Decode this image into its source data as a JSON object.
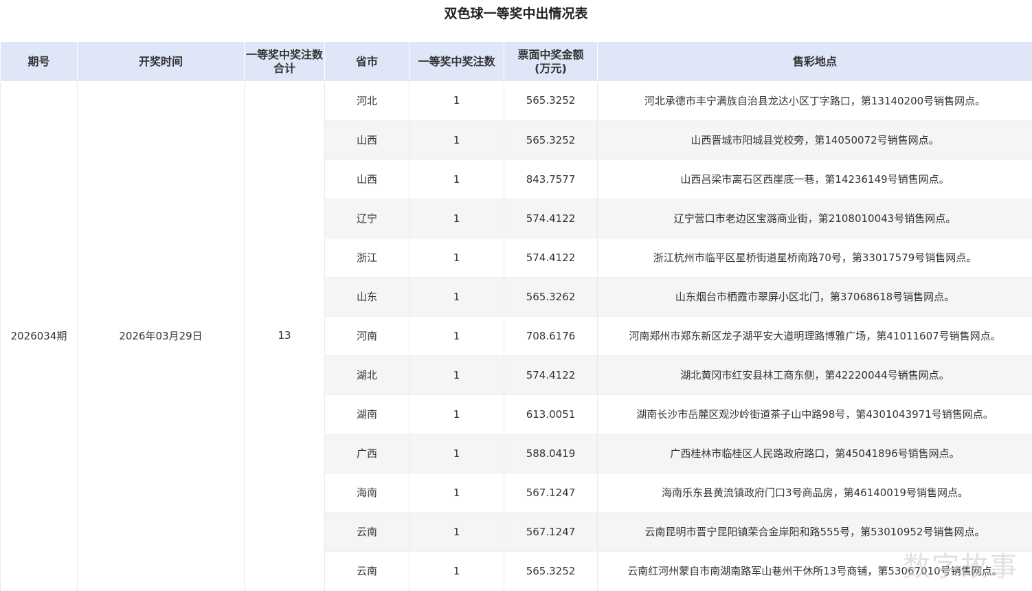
{
  "page": {
    "title": "双色球一等奖中出情况表"
  },
  "table": {
    "headers": {
      "period": "期号",
      "draw_time": "开奖时间",
      "total_count_line1": "一等奖中奖注数",
      "total_count_line2": "合计",
      "province": "省市",
      "count": "一等奖中奖注数",
      "amount_line1": "票面中奖金额",
      "amount_line2": "(万元)",
      "location": "售彩地点"
    },
    "period": "2026034期",
    "draw_time": "2026年03月29日",
    "total_count": "13",
    "rows": [
      {
        "province": "河北",
        "count": "1",
        "amount": "565.3252",
        "location": "河北承德市丰宁满族自治县龙达小区丁字路口，第13140200号销售网点。"
      },
      {
        "province": "山西",
        "count": "1",
        "amount": "565.3252",
        "location": "山西晋城市阳城县党校旁，第14050072号销售网点。"
      },
      {
        "province": "山西",
        "count": "1",
        "amount": "843.7577",
        "location": "山西吕梁市离石区西崖底一巷，第14236149号销售网点。"
      },
      {
        "province": "辽宁",
        "count": "1",
        "amount": "574.4122",
        "location": "辽宁营口市老边区宝潞商业街，第2108010043号销售网点。"
      },
      {
        "province": "浙江",
        "count": "1",
        "amount": "574.4122",
        "location": "浙江杭州市临平区星桥街道星桥南路70号，第33017579号销售网点。"
      },
      {
        "province": "山东",
        "count": "1",
        "amount": "565.3262",
        "location": "山东烟台市栖霞市翠屏小区北门，第37068618号销售网点。"
      },
      {
        "province": "河南",
        "count": "1",
        "amount": "708.6176",
        "location": "河南郑州市郑东新区龙子湖平安大道明理路博雅广场，第41011607号销售网点。"
      },
      {
        "province": "湖北",
        "count": "1",
        "amount": "574.4122",
        "location": "湖北黄冈市红安县林工商东侧，第42220044号销售网点。"
      },
      {
        "province": "湖南",
        "count": "1",
        "amount": "613.0051",
        "location": "湖南长沙市岳麓区观沙岭街道茶子山中路98号，第4301043971号销售网点。"
      },
      {
        "province": "广西",
        "count": "1",
        "amount": "588.0419",
        "location": "广西桂林市临桂区人民路政府路口，第45041896号销售网点。"
      },
      {
        "province": "海南",
        "count": "1",
        "amount": "567.1247",
        "location": "海南乐东县黄流镇政府门口3号商品房，第46140019号销售网点。"
      },
      {
        "province": "云南",
        "count": "1",
        "amount": "567.1247",
        "location": "云南昆明市晋宁昆阳镇荣合金岸阳和路555号，第53010952号销售网点。"
      },
      {
        "province": "云南",
        "count": "1",
        "amount": "565.3252",
        "location": "云南红河州蒙自市南湖南路军山巷州干休所13号商铺，第53067010号销售网点。"
      }
    ]
  },
  "watermark": "数字故事"
}
